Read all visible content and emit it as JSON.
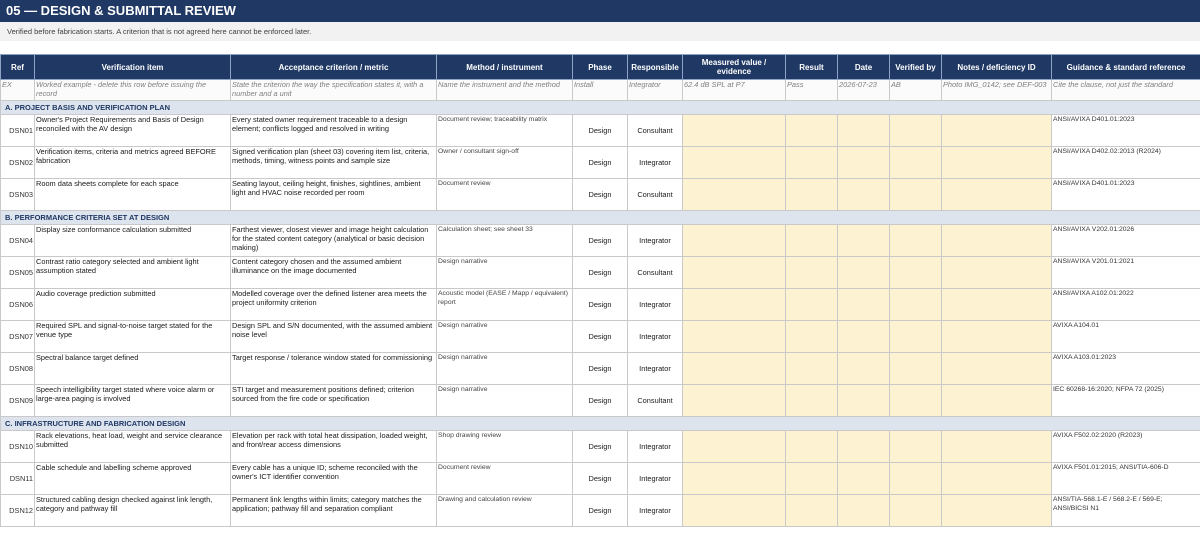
{
  "header": {
    "title": "05  —  DESIGN & SUBMITTAL REVIEW",
    "subtitle": "Verified before fabrication starts. A criterion that is not agreed here cannot be enforced later."
  },
  "columns": [
    "Ref",
    "Verification item",
    "Acceptance criterion / metric",
    "Method / instrument",
    "Phase",
    "Responsible",
    "Measured value / evidence",
    "Result",
    "Date",
    "Verified by",
    "Notes / deficiency ID",
    "Guidance & standard reference"
  ],
  "example": {
    "ref": "EX",
    "item": "Worked example - delete this row before issuing the record",
    "criterion": "State the criterion the way the specification states it, with a number and a unit",
    "method": "Name the instrument and the method",
    "phase": "Install",
    "responsible": "Integrator",
    "measured": "62.4 dB SPL at P7",
    "result": "Pass",
    "date": "2026-07-23",
    "verified_by": "AB",
    "notes": "Photo IMG_0142; see DEF-003",
    "guidance": "Cite the clause, not just the standard"
  },
  "sections": [
    {
      "title": "A. PROJECT BASIS AND VERIFICATION PLAN",
      "rows": [
        {
          "ref": "DSN01",
          "item": "Owner's Project Requirements and Basis of Design reconciled with the AV design",
          "criterion": "Every stated owner requirement traceable to a design element; conflicts logged and resolved in writing",
          "method": "Document review; traceability matrix",
          "phase": "Design",
          "responsible": "Consultant",
          "guidance": "ANSI/AVIXA D401.01:2023"
        },
        {
          "ref": "DSN02",
          "item": "Verification items, criteria and metrics agreed BEFORE fabrication",
          "criterion": "Signed verification plan (sheet 03) covering item list, criteria, methods, timing, witness points and sample size",
          "method": "Owner / consultant sign-off",
          "phase": "Design",
          "responsible": "Integrator",
          "guidance": "ANSI/AVIXA D402.02:2013 (R2024)"
        },
        {
          "ref": "DSN03",
          "item": "Room data sheets complete for each space",
          "criterion": "Seating layout, ceiling height, finishes, sightlines, ambient light and HVAC noise recorded per room",
          "method": "Document review",
          "phase": "Design",
          "responsible": "Consultant",
          "guidance": "ANSI/AVIXA D401.01:2023"
        }
      ]
    },
    {
      "title": "B. PERFORMANCE CRITERIA SET AT DESIGN",
      "rows": [
        {
          "ref": "DSN04",
          "item": "Display size conformance calculation submitted",
          "criterion": "Farthest viewer, closest viewer and image height calculation for the stated content category (analytical or basic decision making)",
          "method": "Calculation sheet; see sheet 33",
          "phase": "Design",
          "responsible": "Integrator",
          "guidance": "ANSI/AVIXA V202.01:2026"
        },
        {
          "ref": "DSN05",
          "item": "Contrast ratio category selected and ambient light assumption stated",
          "criterion": "Content category chosen and the assumed ambient illuminance on the image documented",
          "method": "Design narrative",
          "phase": "Design",
          "responsible": "Consultant",
          "guidance": "ANSI/AVIXA V201.01:2021"
        },
        {
          "ref": "DSN06",
          "item": "Audio coverage prediction submitted",
          "criterion": "Modelled coverage over the defined listener area meets the project uniformity criterion",
          "method": "Acoustic model (EASE / Mapp / equivalent) report",
          "phase": "Design",
          "responsible": "Integrator",
          "guidance": "ANSI/AVIXA A102.01:2022"
        },
        {
          "ref": "DSN07",
          "item": "Required SPL and signal-to-noise target stated for the venue type",
          "criterion": "Design SPL and S/N documented, with the assumed ambient noise level",
          "method": "Design narrative",
          "phase": "Design",
          "responsible": "Integrator",
          "guidance": "AVIXA A104.01"
        },
        {
          "ref": "DSN08",
          "item": "Spectral balance target defined",
          "criterion": "Target response / tolerance window stated for commissioning",
          "method": "Design narrative",
          "phase": "Design",
          "responsible": "Integrator",
          "guidance": "AVIXA A103.01:2023"
        },
        {
          "ref": "DSN09",
          "item": "Speech intelligibility target stated where voice alarm or large-area paging is involved",
          "criterion": "STI target and measurement positions defined; criterion sourced from the fire code or specification",
          "method": "Design narrative",
          "phase": "Design",
          "responsible": "Consultant",
          "guidance": "IEC 60268-16:2020; NFPA 72 (2025)"
        }
      ]
    },
    {
      "title": "C. INFRASTRUCTURE AND FABRICATION DESIGN",
      "rows": [
        {
          "ref": "DSN10",
          "item": "Rack elevations, heat load, weight and service clearance submitted",
          "criterion": "Elevation per rack with total heat dissipation, loaded weight, and front/rear access dimensions",
          "method": "Shop drawing review",
          "phase": "Design",
          "responsible": "Integrator",
          "guidance": "AVIXA F502.02:2020 (R2023)"
        },
        {
          "ref": "DSN11",
          "item": "Cable schedule and labelling scheme approved",
          "criterion": "Every cable has a unique ID; scheme reconciled with the owner's ICT identifier convention",
          "method": "Document review",
          "phase": "Design",
          "responsible": "Integrator",
          "guidance": "AVIXA F501.01:2015; ANSI/TIA-606-D"
        },
        {
          "ref": "DSN12",
          "item": "Structured cabling design checked against link length, category and pathway fill",
          "criterion": "Permanent link lengths within limits; category matches the application; pathway fill and separation compliant",
          "method": "Drawing and calculation review",
          "phase": "Design",
          "responsible": "Integrator",
          "guidance": "ANSI/TIA-568.1-E / 568.2-E / 569-E; ANSI/BICSI N1"
        }
      ]
    }
  ]
}
